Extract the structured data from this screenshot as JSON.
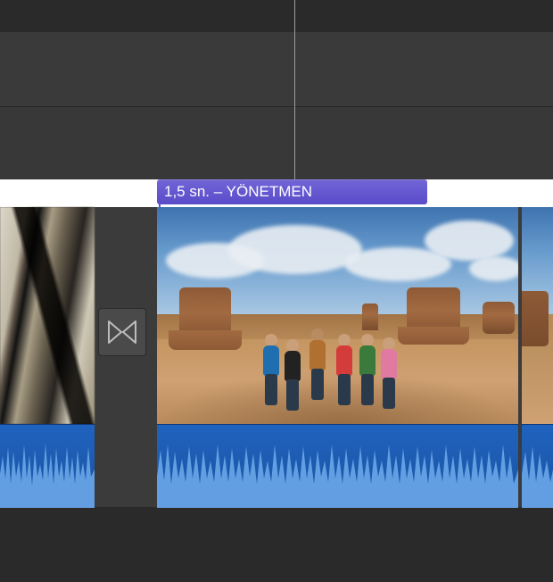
{
  "callout": {
    "target": "title-chip"
  },
  "title_chip": {
    "duration_label": "1,5 sn.",
    "separator": " – ",
    "name": "YÖNETMEN"
  },
  "colors": {
    "title_bg": "#6152d0",
    "audio_bg": "#1f63bf",
    "waveform": "#6aa6e8"
  },
  "timeline": {
    "clips": [
      {
        "id": "clip-prev",
        "has_audio": true
      },
      {
        "id": "clip-main",
        "has_audio": true,
        "has_title": true
      }
    ],
    "transition": {
      "type": "cross-dissolve"
    }
  }
}
